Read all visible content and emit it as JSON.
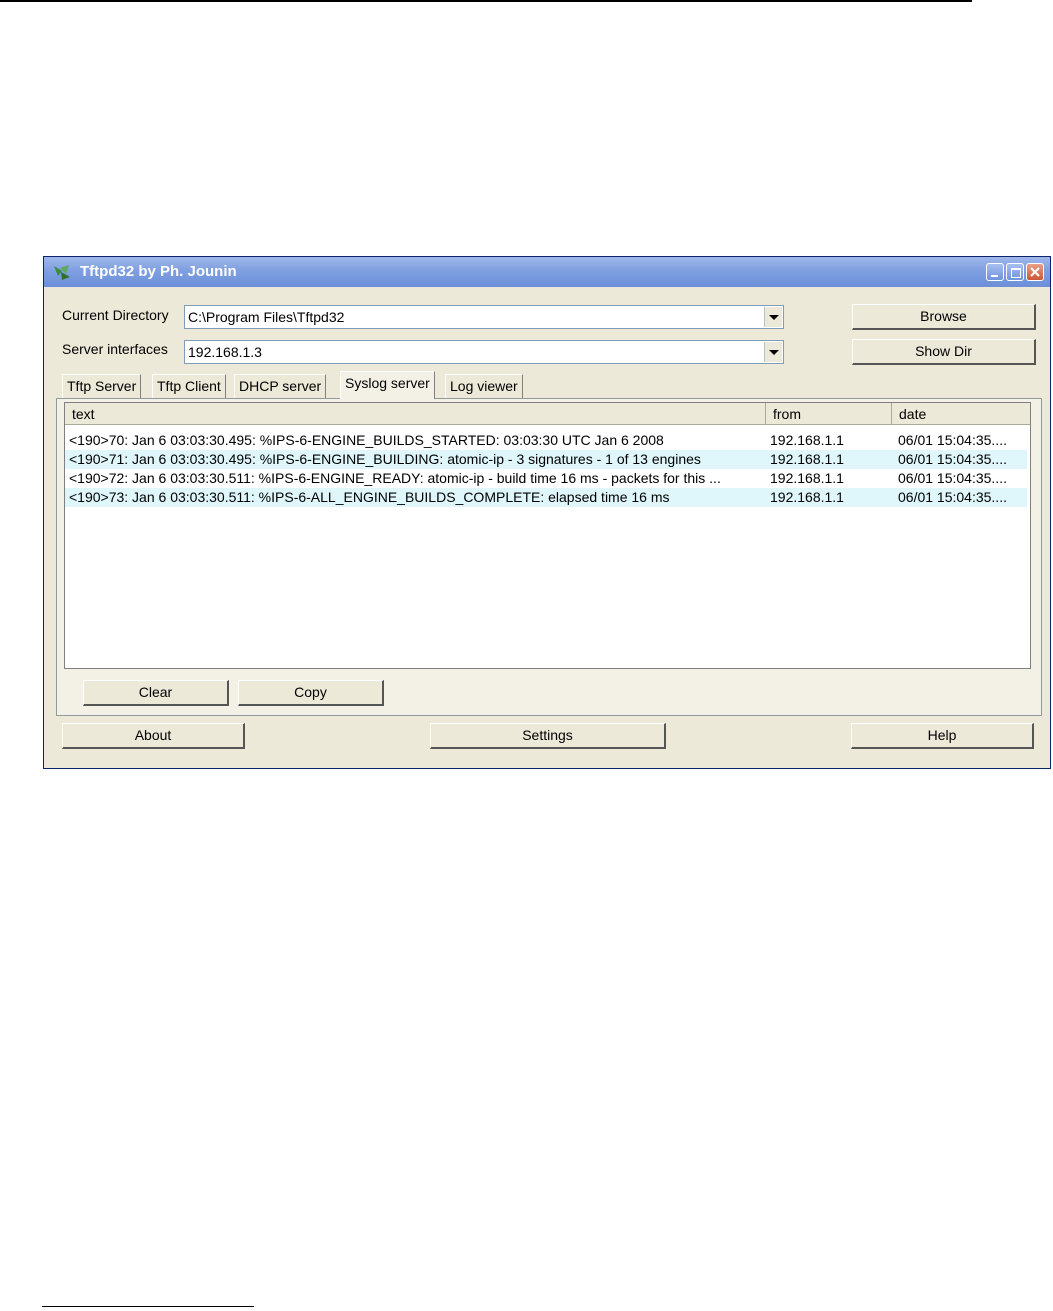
{
  "window": {
    "title": "Tftpd32 by Ph. Jounin"
  },
  "form": {
    "current_directory_label": "Current Directory",
    "current_directory_value": "C:\\Program Files\\Tftpd32",
    "server_interfaces_label": "Server interfaces",
    "server_interfaces_value": "192.168.1.3",
    "browse_label": "Browse",
    "show_dir_label": "Show Dir"
  },
  "tabs": [
    {
      "label": "Tftp Server",
      "active": false
    },
    {
      "label": "Tftp Client",
      "active": false
    },
    {
      "label": "DHCP server",
      "active": false
    },
    {
      "label": "Syslog server",
      "active": true
    },
    {
      "label": "Log viewer",
      "active": false
    }
  ],
  "log_table": {
    "columns": [
      "text",
      "from",
      "date"
    ],
    "rows": [
      {
        "text": "<190>70: Jan  6 03:03:30.495: %IPS-6-ENGINE_BUILDS_STARTED:  03:03:30 UTC Jan 6 2008",
        "from": "192.168.1.1",
        "date": "06/01 15:04:35...."
      },
      {
        "text": "<190>71: Jan  6 03:03:30.495: %IPS-6-ENGINE_BUILDING: atomic-ip - 3 signatures - 1 of 13 engines",
        "from": "192.168.1.1",
        "date": "06/01 15:04:35...."
      },
      {
        "text": "<190>72: Jan  6 03:03:30.511: %IPS-6-ENGINE_READY: atomic-ip - build time 16 ms - packets for this ...",
        "from": "192.168.1.1",
        "date": "06/01 15:04:35...."
      },
      {
        "text": "<190>73: Jan  6 03:03:30.511: %IPS-6-ALL_ENGINE_BUILDS_COMPLETE: elapsed time 16 ms",
        "from": "192.168.1.1",
        "date": "06/01 15:04:35...."
      }
    ]
  },
  "panel_buttons": {
    "clear_label": "Clear",
    "copy_label": "Copy"
  },
  "footer": {
    "about_label": "About",
    "settings_label": "Settings",
    "help_label": "Help"
  },
  "colors": {
    "titlebar": "#7f9fe0",
    "window_face": "#ece9d8",
    "row_highlight": "#dff6fb"
  }
}
